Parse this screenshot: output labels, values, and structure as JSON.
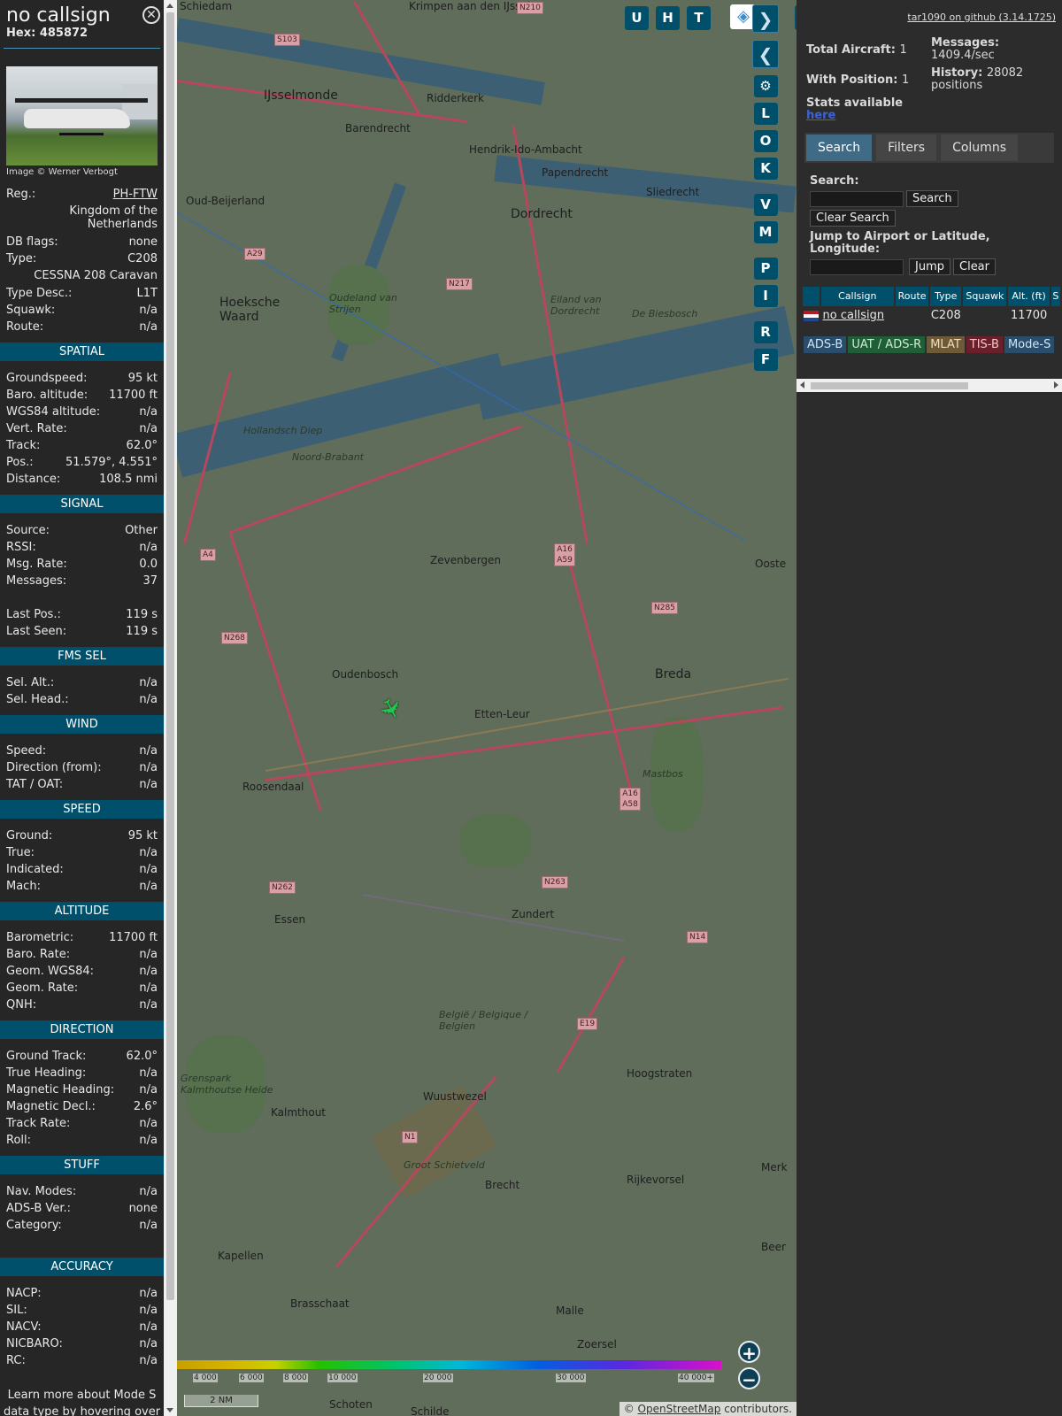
{
  "sidebar": {
    "callsign": "no callsign",
    "hex_label": "Hex:",
    "hex": "485872",
    "close_glyph": "✕",
    "image_credit": "Image © Werner Verbogt",
    "info": [
      {
        "label": "Reg.:",
        "value": "PH-FTW",
        "link": true
      },
      {
        "label": "",
        "value": "Kingdom of the Netherlands",
        "multi": true
      },
      {
        "label": "DB flags:",
        "value": "none"
      },
      {
        "label": "Type:",
        "value": "C208"
      },
      {
        "label": "",
        "value": "CESSNA 208 Caravan",
        "multi": true
      },
      {
        "label": "Type Desc.:",
        "value": "L1T"
      },
      {
        "label": "Squawk:",
        "value": "n/a"
      },
      {
        "label": "Route:",
        "value": "n/a"
      }
    ],
    "sections": [
      {
        "title": "SPATIAL",
        "rows": [
          {
            "label": "Groundspeed:",
            "value": "95 kt"
          },
          {
            "label": "Baro. altitude:",
            "value": "11700 ft"
          },
          {
            "label": "WGS84 altitude:",
            "value": "n/a"
          },
          {
            "label": "Vert. Rate:",
            "value": "n/a"
          },
          {
            "label": "Track:",
            "value": "62.0°"
          },
          {
            "label": "Pos.:",
            "value": "51.579°, 4.551°"
          },
          {
            "label": "Distance:",
            "value": "108.5 nmi"
          }
        ]
      },
      {
        "title": "SIGNAL",
        "rows": [
          {
            "label": "Source:",
            "value": "Other"
          },
          {
            "label": "RSSI:",
            "value": "n/a"
          },
          {
            "label": "Msg. Rate:",
            "value": "0.0"
          },
          {
            "label": "Messages:",
            "value": "37"
          },
          {
            "label": "",
            "value": ""
          },
          {
            "label": "Last Pos.:",
            "value": "119 s"
          },
          {
            "label": "Last Seen:",
            "value": "119 s"
          }
        ]
      },
      {
        "title": "FMS SEL",
        "rows": [
          {
            "label": "Sel. Alt.:",
            "value": "n/a"
          },
          {
            "label": "Sel. Head.:",
            "value": "n/a"
          }
        ]
      },
      {
        "title": "WIND",
        "rows": [
          {
            "label": "Speed:",
            "value": "n/a"
          },
          {
            "label": "Direction (from):",
            "value": "n/a"
          },
          {
            "label": "TAT / OAT:",
            "value": "n/a"
          }
        ]
      },
      {
        "title": "SPEED",
        "rows": [
          {
            "label": "Ground:",
            "value": "95 kt"
          },
          {
            "label": "True:",
            "value": "n/a"
          },
          {
            "label": "Indicated:",
            "value": "n/a"
          },
          {
            "label": "Mach:",
            "value": "n/a"
          }
        ]
      },
      {
        "title": "ALTITUDE",
        "rows": [
          {
            "label": "Barometric:",
            "value": "11700 ft"
          },
          {
            "label": "Baro. Rate:",
            "value": "n/a"
          },
          {
            "label": "Geom. WGS84:",
            "value": "n/a"
          },
          {
            "label": "Geom. Rate:",
            "value": "n/a"
          },
          {
            "label": "QNH:",
            "value": "n/a"
          }
        ]
      },
      {
        "title": "DIRECTION",
        "rows": [
          {
            "label": "Ground Track:",
            "value": "62.0°"
          },
          {
            "label": "True Heading:",
            "value": "n/a"
          },
          {
            "label": "Magnetic Heading:",
            "value": "n/a"
          },
          {
            "label": "Magnetic Decl.:",
            "value": "2.6°"
          },
          {
            "label": "Track Rate:",
            "value": "n/a"
          },
          {
            "label": "Roll:",
            "value": "n/a"
          }
        ]
      },
      {
        "title": "STUFF",
        "rows": [
          {
            "label": "Nav. Modes:",
            "value": "n/a"
          },
          {
            "label": "ADS-B Ver.:",
            "value": "none"
          },
          {
            "label": "Category:",
            "value": "n/a"
          },
          {
            "label": "",
            "value": ""
          }
        ]
      },
      {
        "title": "ACCURACY",
        "rows": [
          {
            "label": "NACP:",
            "value": "n/a"
          },
          {
            "label": "SIL:",
            "value": "n/a"
          },
          {
            "label": "NACV:",
            "value": "n/a"
          },
          {
            "label": "NICBARO:",
            "value": "n/a"
          },
          {
            "label": "RC:",
            "value": "n/a"
          }
        ]
      }
    ],
    "footnote": "Learn more about Mode S data type by hovering over each data label."
  },
  "map": {
    "top_buttons": [
      "U",
      "H",
      "T"
    ],
    "side_buttons": [
      "L",
      "O",
      "K",
      "V",
      "M",
      "P",
      "I",
      "R",
      "F"
    ],
    "expand_glyph": "◂▸",
    "next_glyph": "❯",
    "prev_glyph": "❮",
    "settings_glyph": "⚙",
    "layers_glyph": "◈",
    "aircraft_glyph": "✈",
    "aircraft_color": "#1ec84a",
    "towns": [
      {
        "name": "Schiedam",
        "cls": ""
      },
      {
        "name": "Krimpen aan den IJssel",
        "cls": ""
      },
      {
        "name": "IJsselmonde",
        "cls": "big"
      },
      {
        "name": "Ridderkerk",
        "cls": ""
      },
      {
        "name": "Barendrecht",
        "cls": ""
      },
      {
        "name": "Hendrik-Ido-Ambacht",
        "cls": ""
      },
      {
        "name": "Papendrecht",
        "cls": ""
      },
      {
        "name": "Sliedrecht",
        "cls": ""
      },
      {
        "name": "Oud-Beijerland",
        "cls": ""
      },
      {
        "name": "Dordrecht",
        "cls": "big"
      },
      {
        "name": "Hoeksche Waard",
        "cls": "big"
      },
      {
        "name": "Oudeland van Strijen",
        "cls": "it"
      },
      {
        "name": "Eiland van Dordrecht",
        "cls": "it"
      },
      {
        "name": "De Biesbosch",
        "cls": "it"
      },
      {
        "name": "Hollandsch Diep",
        "cls": "it"
      },
      {
        "name": "Noord-Brabant",
        "cls": "it"
      },
      {
        "name": "Zevenbergen",
        "cls": ""
      },
      {
        "name": "Oudenbosch",
        "cls": ""
      },
      {
        "name": "Etten-Leur",
        "cls": ""
      },
      {
        "name": "Breda",
        "cls": "big"
      },
      {
        "name": "Mastbos",
        "cls": "it"
      },
      {
        "name": "Roosendaal",
        "cls": ""
      },
      {
        "name": "Essen",
        "cls": ""
      },
      {
        "name": "Zundert",
        "cls": ""
      },
      {
        "name": "België / Belgique / Belgien",
        "cls": "it"
      },
      {
        "name": "Hoogstraten",
        "cls": ""
      },
      {
        "name": "Grenspark Kalmthoutse Heide",
        "cls": "it"
      },
      {
        "name": "Kalmthout",
        "cls": ""
      },
      {
        "name": "Wuustwezel",
        "cls": ""
      },
      {
        "name": "Groot Schietveld",
        "cls": "it"
      },
      {
        "name": "Brecht",
        "cls": ""
      },
      {
        "name": "Rijkevorsel",
        "cls": ""
      },
      {
        "name": "Kapellen",
        "cls": ""
      },
      {
        "name": "Brasschaat",
        "cls": ""
      },
      {
        "name": "Malle",
        "cls": ""
      },
      {
        "name": "Zoersel",
        "cls": ""
      },
      {
        "name": "Schoten",
        "cls": ""
      },
      {
        "name": "Schilde",
        "cls": ""
      },
      {
        "name": "Ooste",
        "cls": ""
      },
      {
        "name": "Merk",
        "cls": ""
      },
      {
        "name": "Beer",
        "cls": ""
      }
    ],
    "shields": [
      "S103",
      "N210",
      "A29",
      "N217",
      "A4",
      "A16 A59",
      "N285",
      "N268",
      "A16 A58",
      "N262",
      "N263",
      "N14",
      "E19",
      "N1"
    ],
    "altitude_labels": [
      "4 000",
      "6 000",
      "8 000",
      "10 000",
      "20 000",
      "30 000",
      "40 000+"
    ],
    "zoom_in": "+",
    "zoom_out": "−",
    "scale": "2 NM",
    "attribution_prefix": "© ",
    "attribution_link": "OpenStreetMap",
    "attribution_suffix": " contributors."
  },
  "panel": {
    "github_link": "tar1090 on github (3.14.1725)",
    "total_aircraft_label": "Total Aircraft:",
    "total_aircraft": "1",
    "with_position_label": "With Position:",
    "with_position": "1",
    "messages_label": "Messages:",
    "messages": "1409.4/sec",
    "history_label": "History:",
    "history": "28082 positions",
    "stats_label": "Stats available",
    "stats_link": "here",
    "tabs": [
      "Search",
      "Filters",
      "Columns"
    ],
    "search_label": "Search:",
    "search_button": "Search",
    "clear_search_button": "Clear Search",
    "jump_label": "Jump to Airport or Latitude, Longitude:",
    "jump_button": "Jump",
    "clear_button": "Clear",
    "columns": [
      "Callsign",
      "Route",
      "Type",
      "Squawk",
      "Alt. (ft)",
      "S"
    ],
    "rows": [
      {
        "callsign": "no callsign",
        "route": "",
        "type": "C208",
        "squawk": "",
        "alt": "11700",
        "s": ""
      }
    ],
    "badges": [
      {
        "label": "ADS-B",
        "cls": "b-adsb"
      },
      {
        "label": "UAT / ADS-R",
        "cls": "b-uat"
      },
      {
        "label": "MLAT",
        "cls": "b-mlat"
      },
      {
        "label": "TIS-B",
        "cls": "b-tisb"
      },
      {
        "label": "Mode-S",
        "cls": "b-modes"
      }
    ]
  }
}
